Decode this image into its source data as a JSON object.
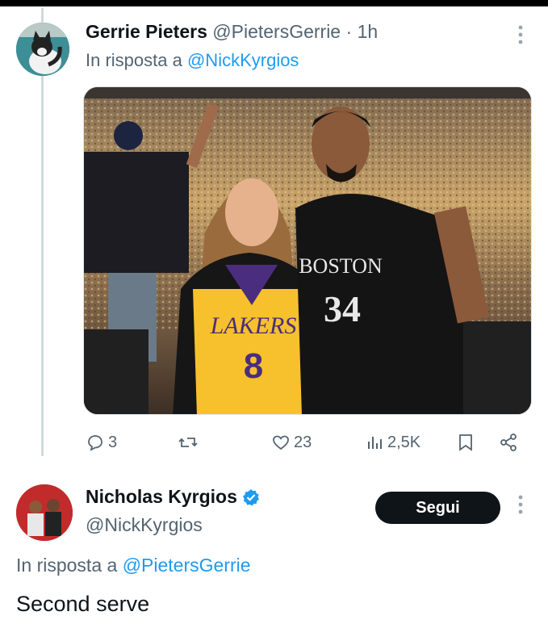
{
  "colors": {
    "accent": "#1d9bf0",
    "text_primary": "#0f1419",
    "text_secondary": "#536471",
    "thread_line": "#cfd9de",
    "follow_button_bg": "#0f1419"
  },
  "tweet1": {
    "name": "Gerrie Pieters",
    "handle": "@PietersGerrie",
    "separator": "·",
    "time": "1h",
    "reply_prefix": "In risposta a",
    "reply_to": "@NickKyrgios",
    "more_icon": "more-vertical-icon",
    "media": {
      "jersey_left_team": "LAKERS",
      "jersey_left_number": "8",
      "jersey_right_team": "BOSTON",
      "jersey_right_number": "34"
    },
    "actions": {
      "reply_icon": "comment-icon",
      "reply_count": "3",
      "retweet_icon": "retweet-icon",
      "like_icon": "heart-icon",
      "like_count": "23",
      "views_icon": "views-icon",
      "views_count": "2,5K",
      "bookmark_icon": "bookmark-icon",
      "share_icon": "share-icon"
    }
  },
  "tweet2": {
    "name": "Nicholas Kyrgios",
    "verified_icon": "verified-badge-icon",
    "handle": "@NickKyrgios",
    "follow_label": "Segui",
    "reply_prefix": "In risposta a",
    "reply_to": "@PietersGerrie",
    "text": "Second serve"
  }
}
